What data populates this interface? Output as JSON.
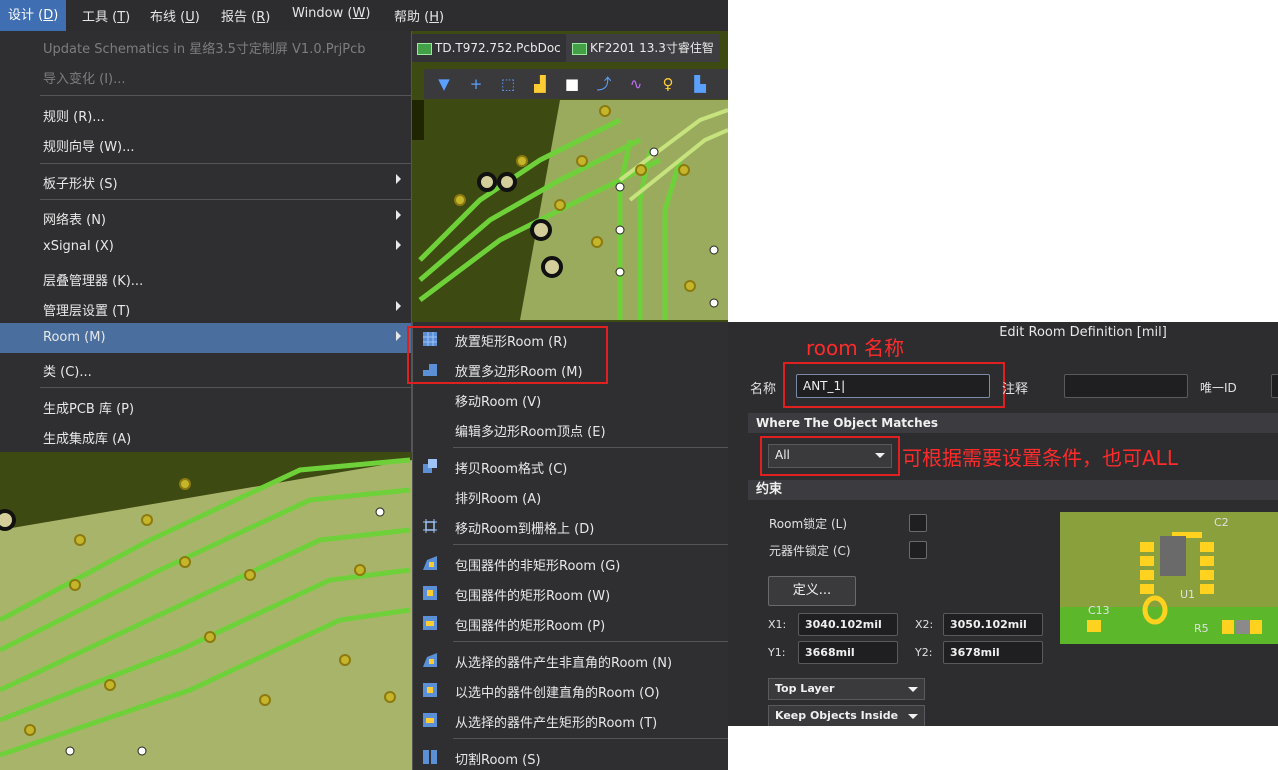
{
  "menubar": {
    "items": [
      {
        "label": "设计 (",
        "key": "D",
        "tail": ")"
      },
      {
        "label": "工具 (",
        "key": "T",
        "tail": ")"
      },
      {
        "label": "布线 (",
        "key": "U",
        "tail": ")"
      },
      {
        "label": "报告 (",
        "key": "R",
        "tail": ")"
      },
      {
        "label": "Window (",
        "key": "W",
        "tail": ")"
      },
      {
        "label": "帮助 (",
        "key": "H",
        "tail": ")"
      }
    ]
  },
  "tabs": [
    {
      "label": "TD.T972.752.PcbDoc"
    },
    {
      "label": "KF2201 13.3寸睿住智"
    }
  ],
  "design_menu": {
    "items": [
      {
        "label": "Update Schematics in 星络3.5寸定制屏 V1.0.PrjPcb",
        "state": "disabled"
      },
      {
        "label": "导入变化 (I)...",
        "state": "disabled"
      },
      {
        "label": "规则 (R)...",
        "state": "normal"
      },
      {
        "label": "规则向导 (W)...",
        "state": "normal"
      },
      {
        "label": "板子形状 (S)",
        "state": "submenu"
      },
      {
        "label": "网络表 (N)",
        "state": "submenu"
      },
      {
        "label": "xSignal (X)",
        "state": "submenu"
      },
      {
        "label": "层叠管理器 (K)...",
        "state": "normal"
      },
      {
        "label": "管理层设置 (T)",
        "state": "submenu"
      },
      {
        "label": "Room (M)",
        "state": "selected"
      },
      {
        "label": "类 (C)...",
        "state": "normal"
      },
      {
        "label": "生成PCB 库 (P)",
        "state": "normal"
      },
      {
        "label": "生成集成库 (A)",
        "state": "normal"
      }
    ]
  },
  "room_submenu": {
    "items": [
      {
        "label": "放置矩形Room (R)",
        "icon": "rect-room-icon"
      },
      {
        "label": "放置多边形Room (M)",
        "icon": "polygon-room-icon"
      },
      {
        "label": "移动Room (V)",
        "icon": ""
      },
      {
        "label": "编辑多边形Room顶点 (E)",
        "icon": ""
      },
      {
        "label": "拷贝Room格式 (C)",
        "icon": "copy-format-icon"
      },
      {
        "label": "排列Room (A)",
        "icon": ""
      },
      {
        "label": "移动Room到栅格上 (D)",
        "icon": "snap-grid-icon"
      },
      {
        "label": "包围器件的非矩形Room (G)",
        "icon": "nonrect-room-icon"
      },
      {
        "label": "包围器件的矩形Room (W)",
        "icon": "rect-around-icon"
      },
      {
        "label": "包围器件的矩形Room (P)",
        "icon": "rect-around-icon"
      },
      {
        "label": "从选择的器件产生非直角的Room (N)",
        "icon": "nonrect-room-icon"
      },
      {
        "label": "以选中的器件创建直角的Room (O)",
        "icon": "rect-around-icon"
      },
      {
        "label": "从选择的器件产生矩形的Room (T)",
        "icon": "rect-around-icon"
      },
      {
        "label": "切割Room (S)",
        "icon": "slice-room-icon"
      }
    ]
  },
  "dialog": {
    "title": "Edit Room Definition [mil]",
    "name_label": "名称",
    "name_value": "ANT_1",
    "comment_label": "注释",
    "unique_id_label": "唯一ID",
    "where_section": "Where The Object Matches",
    "match_value": "All",
    "constraints_section": "约束",
    "room_lock_label": "Room锁定 (L)",
    "comp_lock_label": "元器件锁定 (C)",
    "define_button": "定义...",
    "x1_label": "X1:",
    "x1_value": "3040.102mil",
    "x2_label": "X2:",
    "x2_value": "3050.102mil",
    "y1_label": "Y1:",
    "y1_value": "3668mil",
    "y2_label": "Y2:",
    "y2_value": "3678mil",
    "layer_value": "Top Layer",
    "keep_value": "Keep Objects Inside",
    "preview_labels": {
      "c2": "C2",
      "u1": "U1",
      "c13": "C13",
      "r5": "R5"
    }
  },
  "annotations": {
    "room_name": "room 名称",
    "condition": "可根据需要设置条件，也可ALL"
  }
}
